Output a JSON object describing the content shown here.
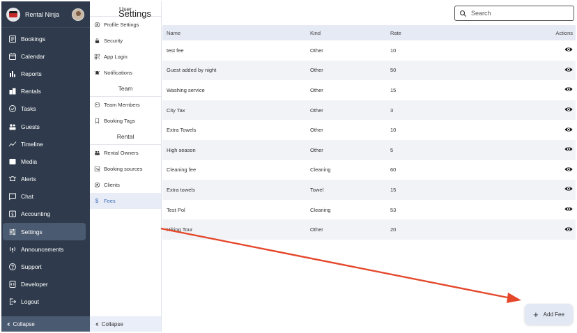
{
  "app": {
    "name": "Rental Ninja"
  },
  "sidebar": {
    "items": [
      {
        "label": "Bookings",
        "icon": "bookings-icon"
      },
      {
        "label": "Calendar",
        "icon": "calendar-icon"
      },
      {
        "label": "Reports",
        "icon": "reports-icon"
      },
      {
        "label": "Rentals",
        "icon": "rentals-icon"
      },
      {
        "label": "Tasks",
        "icon": "tasks-icon"
      },
      {
        "label": "Guests",
        "icon": "guests-icon"
      },
      {
        "label": "Timeline",
        "icon": "timeline-icon"
      },
      {
        "label": "Media",
        "icon": "media-icon"
      },
      {
        "label": "Alerts",
        "icon": "alerts-icon"
      },
      {
        "label": "Chat",
        "icon": "chat-icon"
      },
      {
        "label": "Accounting",
        "icon": "accounting-icon"
      },
      {
        "label": "Settings",
        "icon": "settings-icon",
        "active": true
      },
      {
        "label": "Announcements",
        "icon": "announcements-icon"
      },
      {
        "label": "Support",
        "icon": "support-icon"
      },
      {
        "label": "Developer",
        "icon": "developer-icon"
      },
      {
        "label": "Logout",
        "icon": "logout-icon"
      }
    ],
    "collapse_label": "Collapse"
  },
  "settings_menu": {
    "sections": [
      {
        "title": "User",
        "items": [
          "Profile Settings",
          "Security",
          "App Login",
          "Notifications"
        ]
      },
      {
        "title": "Team",
        "items": [
          "Team Members",
          "Booking Tags"
        ]
      },
      {
        "title": "Rental",
        "items": [
          "Rental Owners",
          "Booking sources",
          "Clients",
          "Fees"
        ]
      }
    ],
    "active_item": "Fees",
    "collapse_label": "Collapse"
  },
  "header": {
    "title": "Settings"
  },
  "search": {
    "placeholder": "Search"
  },
  "table": {
    "columns": [
      "Name",
      "Kind",
      "Rate",
      "Actions"
    ],
    "rows": [
      {
        "name": "test fee",
        "kind": "Other",
        "rate": "10"
      },
      {
        "name": "Guest added by night",
        "kind": "Other",
        "rate": "50"
      },
      {
        "name": "Washing service",
        "kind": "Other",
        "rate": "15"
      },
      {
        "name": "City Tax",
        "kind": "Other",
        "rate": "3"
      },
      {
        "name": "Extra Towels",
        "kind": "Other",
        "rate": "10"
      },
      {
        "name": "High season",
        "kind": "Other",
        "rate": "5"
      },
      {
        "name": "Cleaning fee",
        "kind": "Cleaning",
        "rate": "60"
      },
      {
        "name": "Extra towels",
        "kind": "Towel",
        "rate": "15"
      },
      {
        "name": "Test Pol",
        "kind": "Cleaning",
        "rate": "53"
      },
      {
        "name": "Hiking Tour",
        "kind": "Other",
        "rate": "20"
      }
    ]
  },
  "fab": {
    "label": "Add Fee"
  },
  "colors": {
    "sidebar_bg": "#2f3b4c",
    "accent": "#3b6fb6",
    "annotation_arrow": "#e4472a"
  }
}
